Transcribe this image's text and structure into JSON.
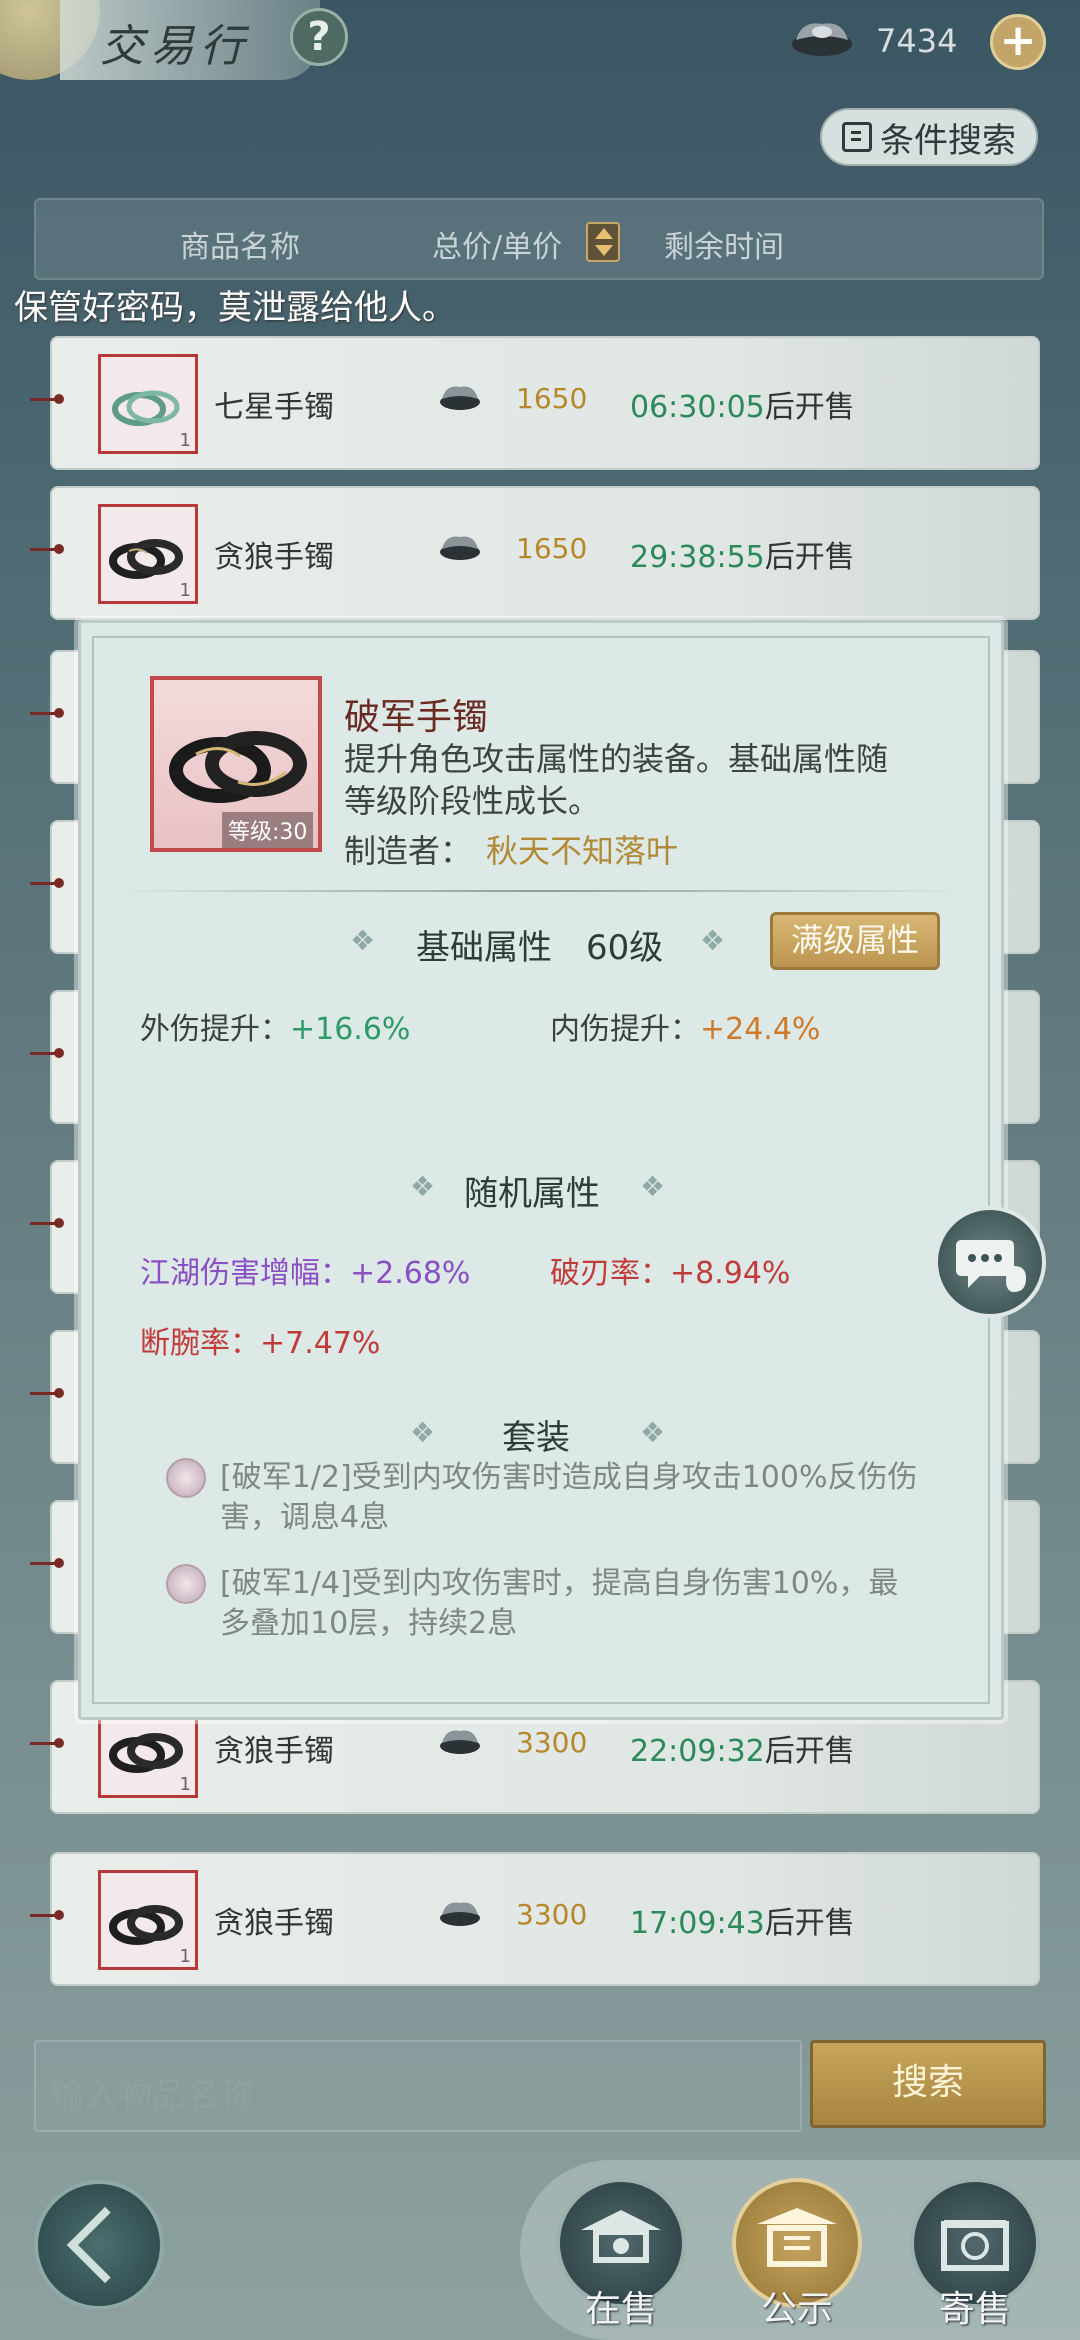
{
  "header": {
    "title": "交易行",
    "help_symbol": "?",
    "currency_value": "7434",
    "add_symbol": "+",
    "condition_search_label": "条件搜索"
  },
  "columns": {
    "name": "商品名称",
    "price": "总价/单价",
    "time": "剩余时间"
  },
  "warning": "保管好密码，莫泄露给他人。",
  "rows": [
    {
      "name": "七星手镯",
      "price": "1650",
      "time": "06:30:05",
      "suffix": "后开售",
      "qty": "1",
      "thumb": "green-bracelet-icon"
    },
    {
      "name": "贪狼手镯",
      "price": "1650",
      "time": "29:38:55",
      "suffix": "后开售",
      "qty": "1",
      "thumb": "black-bracelet-icon"
    },
    {
      "name": "贪狼手镯",
      "price": "3300",
      "time": "22:09:32",
      "suffix": "后开售",
      "qty": "1",
      "thumb": "black-bracelet-icon"
    },
    {
      "name": "贪狼手镯",
      "price": "3300",
      "time": "17:09:43",
      "suffix": "后开售",
      "qty": "1",
      "thumb": "black-bracelet-icon"
    }
  ],
  "bottom": {
    "search_placeholder": "输入物品名称",
    "search_button": "搜索",
    "tabs": [
      "在售",
      "公示",
      "寄售"
    ]
  },
  "modal": {
    "item_name": "破军手镯",
    "item_desc": "提升角色攻击属性的装备。基础属性随等级阶段性成长。",
    "level_label": "等级:30",
    "maker_label": "制造者：",
    "maker_name": "秋天不知落叶",
    "base_section": "基础属性",
    "base_level": "60级",
    "max_button": "满级属性",
    "base_attrs": [
      {
        "key": "外伤提升：",
        "value": "+16.6%"
      },
      {
        "key": "内伤提升：",
        "value": "+24.4%"
      }
    ],
    "random_section": "随机属性",
    "random_attrs": [
      {
        "key": "江湖伤害增幅：",
        "value": "+2.68%"
      },
      {
        "key": "破刃率：",
        "value": "+8.94%"
      },
      {
        "key": "断腕率：",
        "value": "+7.47%"
      }
    ],
    "set_section": "套装",
    "set_effects": [
      "[破军1/2]受到内攻伤害时造成自身攻击100%反伤伤害，调息4息",
      "[破军1/4]受到内攻伤害时，提高自身伤害10%，最多叠加10层，持续2息"
    ]
  },
  "colors": {
    "accent_gold": "#c7a55a",
    "time_green": "#2c8a5a",
    "price_gold": "#b7872c",
    "item_red": "#c44a4a"
  }
}
